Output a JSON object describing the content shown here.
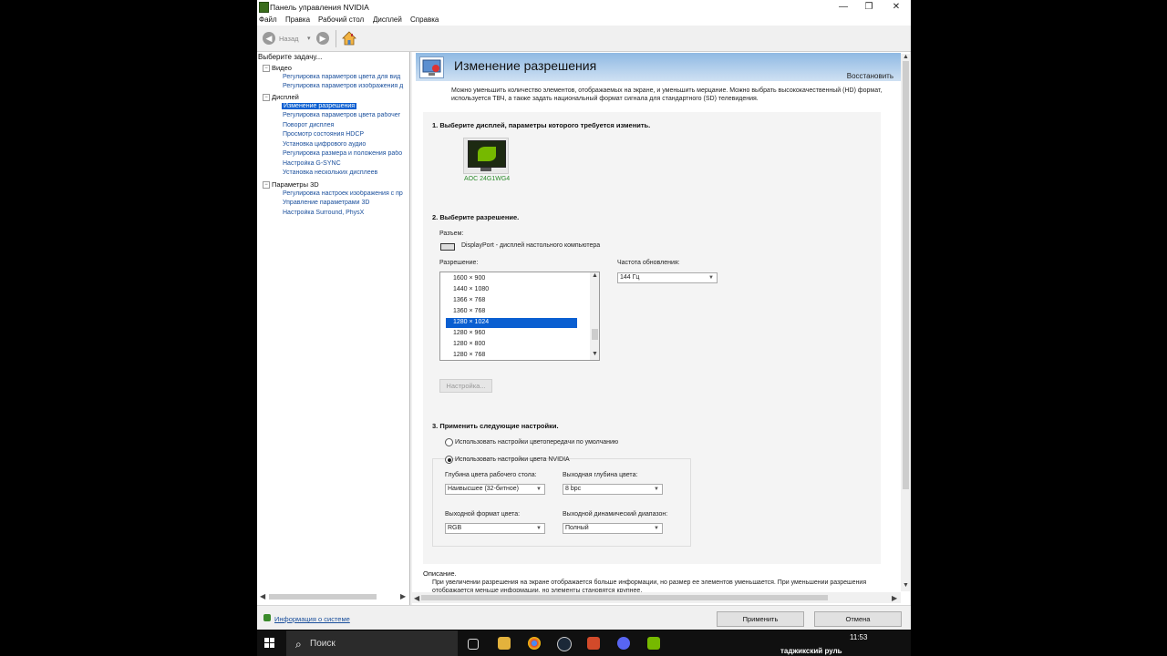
{
  "window": {
    "title": "Панель управления NVIDIA",
    "controls": {
      "minimize": "—",
      "maximize": "❐",
      "close": "✕"
    }
  },
  "menu": [
    "Файл",
    "Правка",
    "Рабочий стол",
    "Дисплей",
    "Справка"
  ],
  "toolbar": {
    "back_label": "Назад",
    "dropdown_arrow": "▾"
  },
  "left_panel": {
    "header": "Выберите задачу...",
    "tree": [
      {
        "type": "category",
        "label": "Видео"
      },
      {
        "type": "link",
        "label": "Регулировка параметров цвета для вид"
      },
      {
        "type": "link",
        "label": "Регулировка параметров изображения д"
      },
      {
        "type": "category",
        "label": "Дисплей"
      },
      {
        "type": "link",
        "label": "Изменение разрешения",
        "selected": true
      },
      {
        "type": "link",
        "label": "Регулировка параметров цвета рабочег"
      },
      {
        "type": "link",
        "label": "Поворот дисплея"
      },
      {
        "type": "link",
        "label": "Просмотр состояния HDCP"
      },
      {
        "type": "link",
        "label": "Установка цифрового аудио"
      },
      {
        "type": "link",
        "label": "Регулировка размера и положения рабо"
      },
      {
        "type": "link",
        "label": "Настройка G-SYNC"
      },
      {
        "type": "link",
        "label": "Установка нескольких дисплеев"
      },
      {
        "type": "category",
        "label": "Параметры 3D"
      },
      {
        "type": "link",
        "label": "Регулировка настроек изображения с пр"
      },
      {
        "type": "link",
        "label": "Управление параметрами 3D"
      },
      {
        "type": "link",
        "label": "Настройка Surround, PhysX"
      }
    ],
    "expander": "−"
  },
  "page": {
    "title": "Изменение разрешения",
    "restore": "Восстановить",
    "intro": "Можно уменьшить количество элементов, отображаемых на экране, и уменьшить мерцание. Можно выбрать высококачественный (HD) формат, используется ТВЧ, а также задать национальный формат сигнала для стандартного (SD) телевидения.",
    "step1": "1. Выберите дисплей, параметры которого требуется изменить.",
    "monitor_name": "AOC 24G1WG4",
    "step2": "2. Выберите разрешение.",
    "connector_label": "Разъем:",
    "connector_value": "DisplayPort - дисплей настольного компьютера",
    "resolution_label": "Разрешение:",
    "resolutions": [
      "1600 × 900",
      "1440 × 1080",
      "1366 × 768",
      "1360 × 768",
      "1280 × 1024",
      "1280 × 960",
      "1280 × 800",
      "1280 × 768"
    ],
    "selected_resolution_index": 4,
    "refresh_label": "Частота обновления:",
    "refresh_value": "144 Гц",
    "customize_button": "Настройка...",
    "step3": "3. Применить следующие настройки.",
    "radio_default": "Использовать настройки цветопередачи по умолчанию",
    "radio_nvidia": "Использовать настройки цвета NVIDIA",
    "desktop_depth_label": "Глубина цвета рабочего стола:",
    "desktop_depth_value": "Наивысшее (32-битное)",
    "output_depth_label": "Выходная глубина цвета:",
    "output_depth_value": "8 bpc",
    "output_format_label": "Выходной формат цвета:",
    "output_format_value": "RGB",
    "dynamic_range_label": "Выходной динамический диапазон:",
    "dynamic_range_value": "Полный",
    "description_title": "Описание.",
    "description_text": "При увеличении разрешения на экране отображается больше информации, но размер ее элементов уменьшается. При уменьшении разрешения отображается меньше информации, но элементы становятся крупнее."
  },
  "bottom": {
    "sysinfo_link": "Информация о системе",
    "apply_button": "Применить",
    "cancel_button": "Отмена"
  },
  "taskbar": {
    "search_placeholder": "Поиск",
    "time": "11:53",
    "notification": "таджикский руль"
  },
  "colors": {
    "accent": "#0a5fd1",
    "nvidia_green": "#76b900",
    "link": "#1a4f9c"
  }
}
